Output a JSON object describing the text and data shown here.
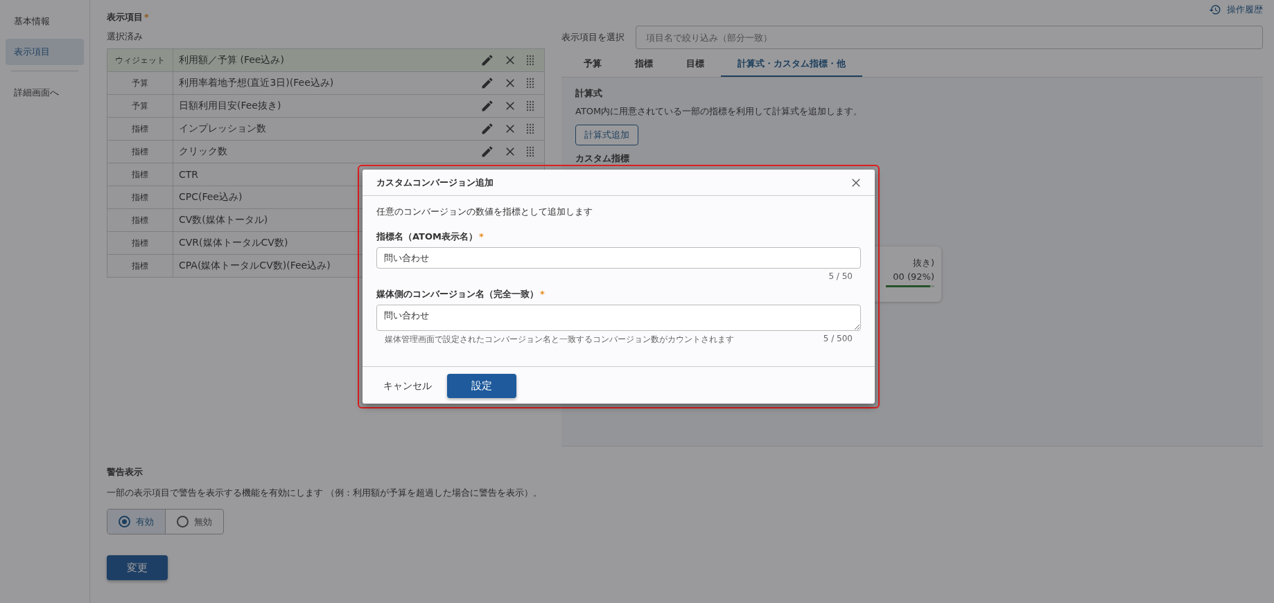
{
  "sidebar": {
    "items": [
      {
        "label": "基本情報",
        "selected": false
      },
      {
        "label": "表示項目",
        "selected": true
      }
    ],
    "link": "詳細画面へ"
  },
  "history_link": "操作履歴",
  "selected_section": {
    "title": "表示項目",
    "required_mark": "*",
    "subtitle": "選択済み",
    "rows": [
      {
        "kind": "widget",
        "type": "ウィジェット",
        "name": "利用額／予算 (Fee込み)",
        "actions": true
      },
      {
        "kind": "normal",
        "type": "予算",
        "name": "利用率着地予想(直近3日)(Fee込み)",
        "actions": true
      },
      {
        "kind": "normal",
        "type": "予算",
        "name": "日額利用目安(Fee抜き)",
        "actions": true
      },
      {
        "kind": "normal",
        "type": "指標",
        "name": "インプレッション数",
        "actions": true
      },
      {
        "kind": "normal",
        "type": "指標",
        "name": "クリック数",
        "actions": true
      },
      {
        "kind": "normal",
        "type": "指標",
        "name": "CTR"
      },
      {
        "kind": "normal",
        "type": "指標",
        "name": "CPC(Fee込み)"
      },
      {
        "kind": "normal",
        "type": "指標",
        "name": "CV数(媒体トータル)"
      },
      {
        "kind": "normal",
        "type": "指標",
        "name": "CVR(媒体トータルCV数)"
      },
      {
        "kind": "normal",
        "type": "指標",
        "name": "CPA(媒体トータルCV数)(Fee込み)"
      }
    ]
  },
  "picker": {
    "label": "表示項目を選択",
    "placeholder": "項目名で絞り込み（部分一致）",
    "tabs": [
      {
        "label": "予算",
        "selected": false
      },
      {
        "label": "指標",
        "selected": false
      },
      {
        "label": "目標",
        "selected": false
      },
      {
        "label": "計算式・カスタム指標・他",
        "selected": true
      }
    ],
    "formula": {
      "title": "計算式",
      "description": "ATOM内に用意されている一部の指標を利用して計算式を追加します。",
      "button": "計算式追加"
    },
    "custom_title": "カスタム指標",
    "card": {
      "line_1": "抜き)",
      "line_2": "00 (92%)",
      "level": 0.92
    }
  },
  "warning": {
    "title": "警告表示",
    "description": "一部の表示項目で警告を表示する機能を有効にします （例：利用額が予算を超過した場合に警告を表示）。",
    "options": [
      {
        "label": "有効",
        "selected": true
      },
      {
        "label": "無効",
        "selected": false
      }
    ]
  },
  "submit_button": "変更",
  "dialog": {
    "title": "カスタムコンバージョン追加",
    "description": "任意のコンバージョンの数値を指標として追加します",
    "fields": [
      {
        "kind": "input",
        "label": "指標名（ATOM表示名）",
        "required_mark": "*",
        "value": "問い合わせ",
        "counter": "5 / 50"
      },
      {
        "kind": "textarea",
        "label": "媒体側のコンバージョン名（完全一致）",
        "required_mark": "*",
        "value": "問い合わせ",
        "hint": "媒体管理画面で設定されたコンバージョン名と一致するコンバージョン数がカウントされます",
        "counter": "5 / 500"
      }
    ],
    "cancel": "キャンセル",
    "confirm": "設定"
  }
}
